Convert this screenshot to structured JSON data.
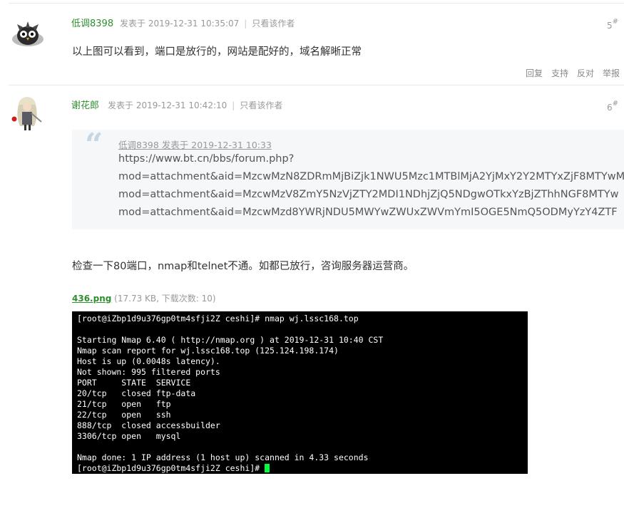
{
  "posts": [
    {
      "author": "低调8398",
      "posted": "发表于 2019-12-31 10:35:07",
      "only_author": "只看该作者",
      "floor": "5",
      "floor_mark": "#",
      "content": "以上图可以看到，端口是放行的，网站是配好的，域名解晰正常",
      "actions": [
        "回复",
        "支持",
        "反对",
        "举报"
      ]
    },
    {
      "author": "谢花郎",
      "posted": "发表于 2019-12-31 10:42:10",
      "only_author": "只看该作者",
      "floor": "6",
      "floor_mark": "#",
      "quote": {
        "header": "低调8398 发表于 2019-12-31 10:33",
        "lines": [
          "https://www.bt.cn/bbs/forum.php?",
          "mod=attachment&aid=MzcwMzN8ZDRmMjBiZjk1NWU5Mzc1MTBlMjA2YjMxY2Y2MTYxZjF8MTYwM",
          "mod=attachment&aid=MzcwMzV8ZmY5NzVjZTY2MDI1NDhjZjQ5NDgwOTkxYzBjZThhNGF8MTYw",
          "mod=attachment&aid=MzcwMzd8YWRjNDU5MWYwZWUxZWVmYmI5OGE5NmQ5ODMyYzY4ZTF"
        ]
      },
      "content": "检查一下80端口，nmap和telnet不通。如都已放行，咨询服务器运营商。",
      "attachment": {
        "filename": "436.png",
        "info": "(17.73 KB, 下载次数: 10)"
      },
      "terminal": {
        "lines": [
          "[root@iZbp1d9u376gp0tm4sfji2Z ceshi]# nmap wj.lssc168.top",
          "",
          "Starting Nmap 6.40 ( http://nmap.org ) at 2019-12-31 10:40 CST",
          "Nmap scan report for wj.lssc168.top (125.124.198.174)",
          "Host is up (0.0048s latency).",
          "Not shown: 995 filtered ports",
          "PORT     STATE  SERVICE",
          "20/tcp   closed ftp-data",
          "21/tcp   open   ftp",
          "22/tcp   open   ssh",
          "888/tcp  closed accessbuilder",
          "3306/tcp open   mysql",
          "",
          "Nmap done: 1 IP address (1 host up) scanned in 4.33 seconds"
        ],
        "prompt": "[root@iZbp1d9u376gp0tm4sfji2Z ceshi]# "
      }
    }
  ],
  "colors": {
    "author": "#2e8f2e",
    "terminal_bg": "#000000",
    "terminal_cursor": "#00ff3c",
    "quote_bg": "#f5f7f9"
  }
}
